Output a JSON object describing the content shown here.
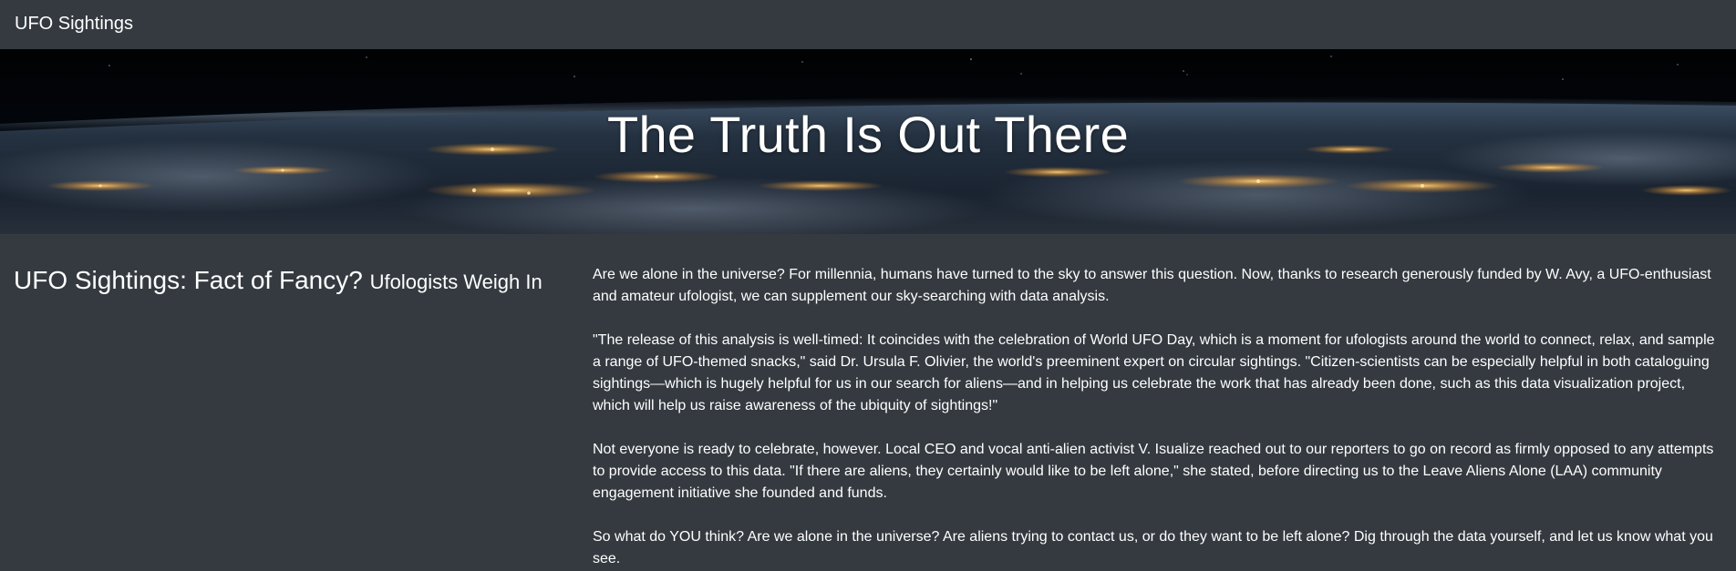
{
  "navbar": {
    "brand": "UFO Sightings"
  },
  "hero": {
    "title": "The Truth Is Out There"
  },
  "article": {
    "heading": "UFO Sightings: Fact of Fancy?",
    "subheading": "Ufologists Weigh In",
    "paragraphs": [
      "Are we alone in the universe? For millennia, humans have turned to the sky to answer this question. Now, thanks to research generously funded by W. Avy, a UFO-enthusiast and amateur ufologist, we can supplement our sky-searching with data analysis.",
      "\"The release of this analysis is well-timed: It coincides with the celebration of World UFO Day, which is a moment for ufologists around the world to connect, relax, and sample a range of UFO-themed snacks,\" said Dr. Ursula F. Olivier, the world's preeminent expert on circular sightings. \"Citizen-scientists can be especially helpful in both cataloguing sightings—which is hugely helpful for us in our search for aliens—and in helping us celebrate the work that has already been done, such as this data visualization project, which will help us raise awareness of the ubiquity of sightings!\"",
      "Not everyone is ready to celebrate, however. Local CEO and vocal anti-alien activist V. Isualize reached out to our reporters to go on record as firmly opposed to any attempts to provide access to this data. \"If there are aliens, they certainly would like to be left alone,\" she stated, before directing us to the Leave Aliens Alone (LAA) community engagement initiative she founded and funds.",
      "So what do YOU think? Are we alone in the universe? Are aliens trying to contact us, or do they want to be left alone? Dig through the data yourself, and let us know what you see."
    ]
  },
  "colors": {
    "background": "#343a40",
    "text": "#ffffff"
  }
}
